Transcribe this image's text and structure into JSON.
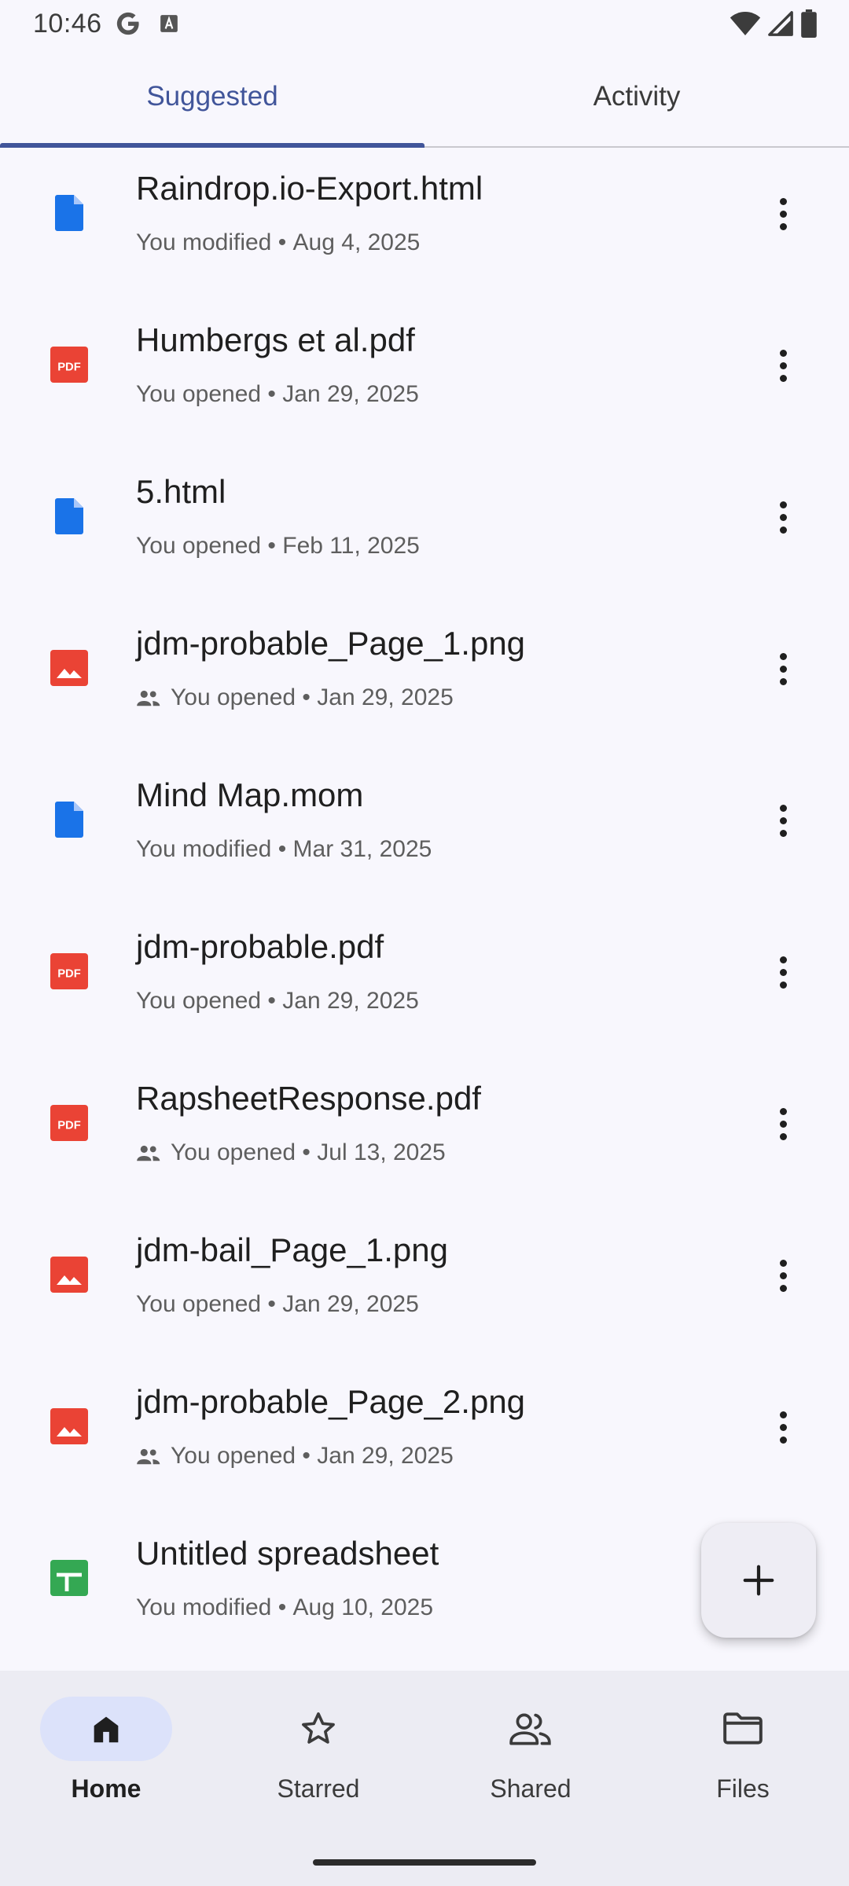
{
  "status_bar": {
    "time": "10:46"
  },
  "tabs": [
    {
      "label": "Suggested",
      "active": true
    },
    {
      "label": "Activity",
      "active": false
    }
  ],
  "files": [
    {
      "name": "Raindrop.io-Export.html",
      "type": "doc",
      "shared": false,
      "action": "You modified",
      "date": "Aug 4, 2025"
    },
    {
      "name": "Humbergs et al.pdf",
      "type": "pdf",
      "shared": false,
      "action": "You opened",
      "date": "Jan 29, 2025"
    },
    {
      "name": "5.html",
      "type": "doc",
      "shared": false,
      "action": "You opened",
      "date": "Feb 11, 2025"
    },
    {
      "name": "jdm-probable_Page_1.png",
      "type": "image",
      "shared": true,
      "action": "You opened",
      "date": "Jan 29, 2025"
    },
    {
      "name": "Mind Map.mom",
      "type": "doc",
      "shared": false,
      "action": "You modified",
      "date": "Mar 31, 2025"
    },
    {
      "name": "jdm-probable.pdf",
      "type": "pdf",
      "shared": false,
      "action": "You opened",
      "date": "Jan 29, 2025"
    },
    {
      "name": "RapsheetResponse.pdf",
      "type": "pdf",
      "shared": true,
      "action": "You opened",
      "date": "Jul 13, 2025"
    },
    {
      "name": "jdm-bail_Page_1.png",
      "type": "image",
      "shared": false,
      "action": "You opened",
      "date": "Jan 29, 2025"
    },
    {
      "name": "jdm-probable_Page_2.png",
      "type": "image",
      "shared": true,
      "action": "You opened",
      "date": "Jan 29, 2025"
    },
    {
      "name": "Untitled spreadsheet",
      "type": "sheet",
      "shared": false,
      "action": "You modified",
      "date": "Aug 10, 2025"
    }
  ],
  "separator": " • ",
  "pdf_badge": "PDF",
  "bottom_nav": [
    {
      "label": "Home",
      "icon": "home-icon",
      "active": true
    },
    {
      "label": "Starred",
      "icon": "star-icon",
      "active": false
    },
    {
      "label": "Shared",
      "icon": "people-icon",
      "active": false
    },
    {
      "label": "Files",
      "icon": "folder-icon",
      "active": false
    }
  ],
  "colors": {
    "accent": "#41559A",
    "doc": "#1A73E8",
    "pdf": "#EA4335",
    "image": "#EA4335",
    "sheet": "#34A853",
    "nav_active_pill": "#DCE2FA"
  }
}
